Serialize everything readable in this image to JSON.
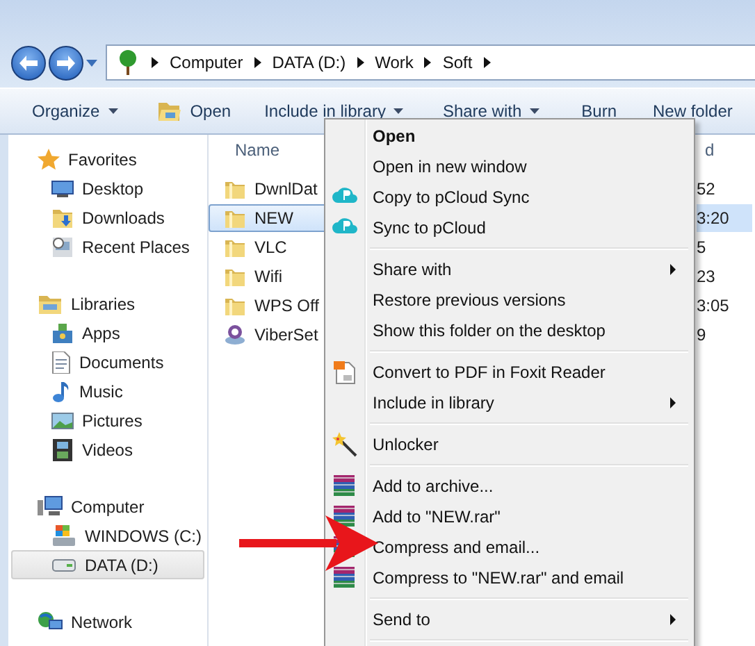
{
  "address_bar": {
    "path": [
      "Computer",
      "DATA (D:)",
      "Work",
      "Soft"
    ]
  },
  "toolbar": [
    {
      "label": "Organize",
      "kind": "dropdown"
    },
    {
      "label": "Open",
      "kind": "open"
    },
    {
      "label": "Include in library",
      "kind": "dropdown"
    },
    {
      "label": "Share with",
      "kind": "dropdown"
    },
    {
      "label": "Burn",
      "kind": "plain"
    },
    {
      "label": "New folder",
      "kind": "plain"
    }
  ],
  "sidebar": [
    {
      "label": "Favorites",
      "kind": "favorites",
      "children": [
        {
          "label": "Desktop",
          "kind": "desktop",
          "selected": false
        },
        {
          "label": "Downloads",
          "kind": "downloads",
          "selected": false
        },
        {
          "label": "Recent Places",
          "kind": "recent",
          "selected": false
        }
      ]
    },
    {
      "label": "Libraries",
      "kind": "libraries",
      "children": [
        {
          "label": "Apps",
          "kind": "apps",
          "selected": false
        },
        {
          "label": "Documents",
          "kind": "documents",
          "selected": false
        },
        {
          "label": "Music",
          "kind": "music",
          "selected": false
        },
        {
          "label": "Pictures",
          "kind": "pictures",
          "selected": false
        },
        {
          "label": "Videos",
          "kind": "videos",
          "selected": false
        }
      ]
    },
    {
      "label": "Computer",
      "kind": "computer",
      "children": [
        {
          "label": "WINDOWS (C:)",
          "kind": "windrive",
          "selected": false
        },
        {
          "label": "DATA (D:)",
          "kind": "drive",
          "selected": true
        }
      ]
    },
    {
      "label": "Network",
      "kind": "network"
    }
  ],
  "file_list": {
    "columns": [
      {
        "label": "Name"
      },
      {
        "label": "d"
      }
    ],
    "rows": [
      {
        "name": "DwnlDat",
        "date": "52",
        "kind": "folder",
        "selected": false
      },
      {
        "name": "NEW",
        "date": "3:20",
        "kind": "folder",
        "selected": true
      },
      {
        "name": "VLC",
        "date": "5",
        "kind": "folder",
        "selected": false
      },
      {
        "name": "Wifi",
        "date": "23",
        "kind": "folder",
        "selected": false
      },
      {
        "name": "WPS Off",
        "date": "3:05",
        "kind": "folder",
        "selected": false
      },
      {
        "name": "ViberSet",
        "date": "9",
        "kind": "installer",
        "selected": false
      }
    ]
  },
  "context_menu": [
    {
      "kind": "plain",
      "label": "Open",
      "default": true,
      "submenu": false
    },
    {
      "kind": "plain",
      "label": "Open in new window",
      "default": false,
      "submenu": false
    },
    {
      "kind": "cloud",
      "label": "Copy to pCloud Sync",
      "default": false,
      "submenu": false
    },
    {
      "kind": "cloud",
      "label": "Sync to pCloud",
      "default": false,
      "submenu": false
    },
    {
      "kind": "separator"
    },
    {
      "kind": "plain",
      "label": "Share with",
      "default": false,
      "submenu": true
    },
    {
      "kind": "plain",
      "label": "Restore previous versions",
      "default": false,
      "submenu": false
    },
    {
      "kind": "plain",
      "label": "Show this folder on the desktop",
      "default": false,
      "submenu": false
    },
    {
      "kind": "separator"
    },
    {
      "kind": "pdf",
      "label": "Convert to PDF in Foxit Reader",
      "default": false,
      "submenu": false
    },
    {
      "kind": "plain",
      "label": "Include in library",
      "default": false,
      "submenu": true
    },
    {
      "kind": "separator"
    },
    {
      "kind": "wand",
      "label": "Unlocker",
      "default": false,
      "submenu": false
    },
    {
      "kind": "separator"
    },
    {
      "kind": "archive",
      "label": "Add to archive...",
      "default": false,
      "submenu": false
    },
    {
      "kind": "archive",
      "label": "Add to \"NEW.rar\"",
      "default": false,
      "submenu": false
    },
    {
      "kind": "archive",
      "label": "Compress and email...",
      "default": false,
      "submenu": false
    },
    {
      "kind": "archive",
      "label": "Compress to \"NEW.rar\" and email",
      "default": false,
      "submenu": false
    },
    {
      "kind": "separator"
    },
    {
      "kind": "plain",
      "label": "Send to",
      "default": false,
      "submenu": true
    },
    {
      "kind": "separator"
    }
  ]
}
